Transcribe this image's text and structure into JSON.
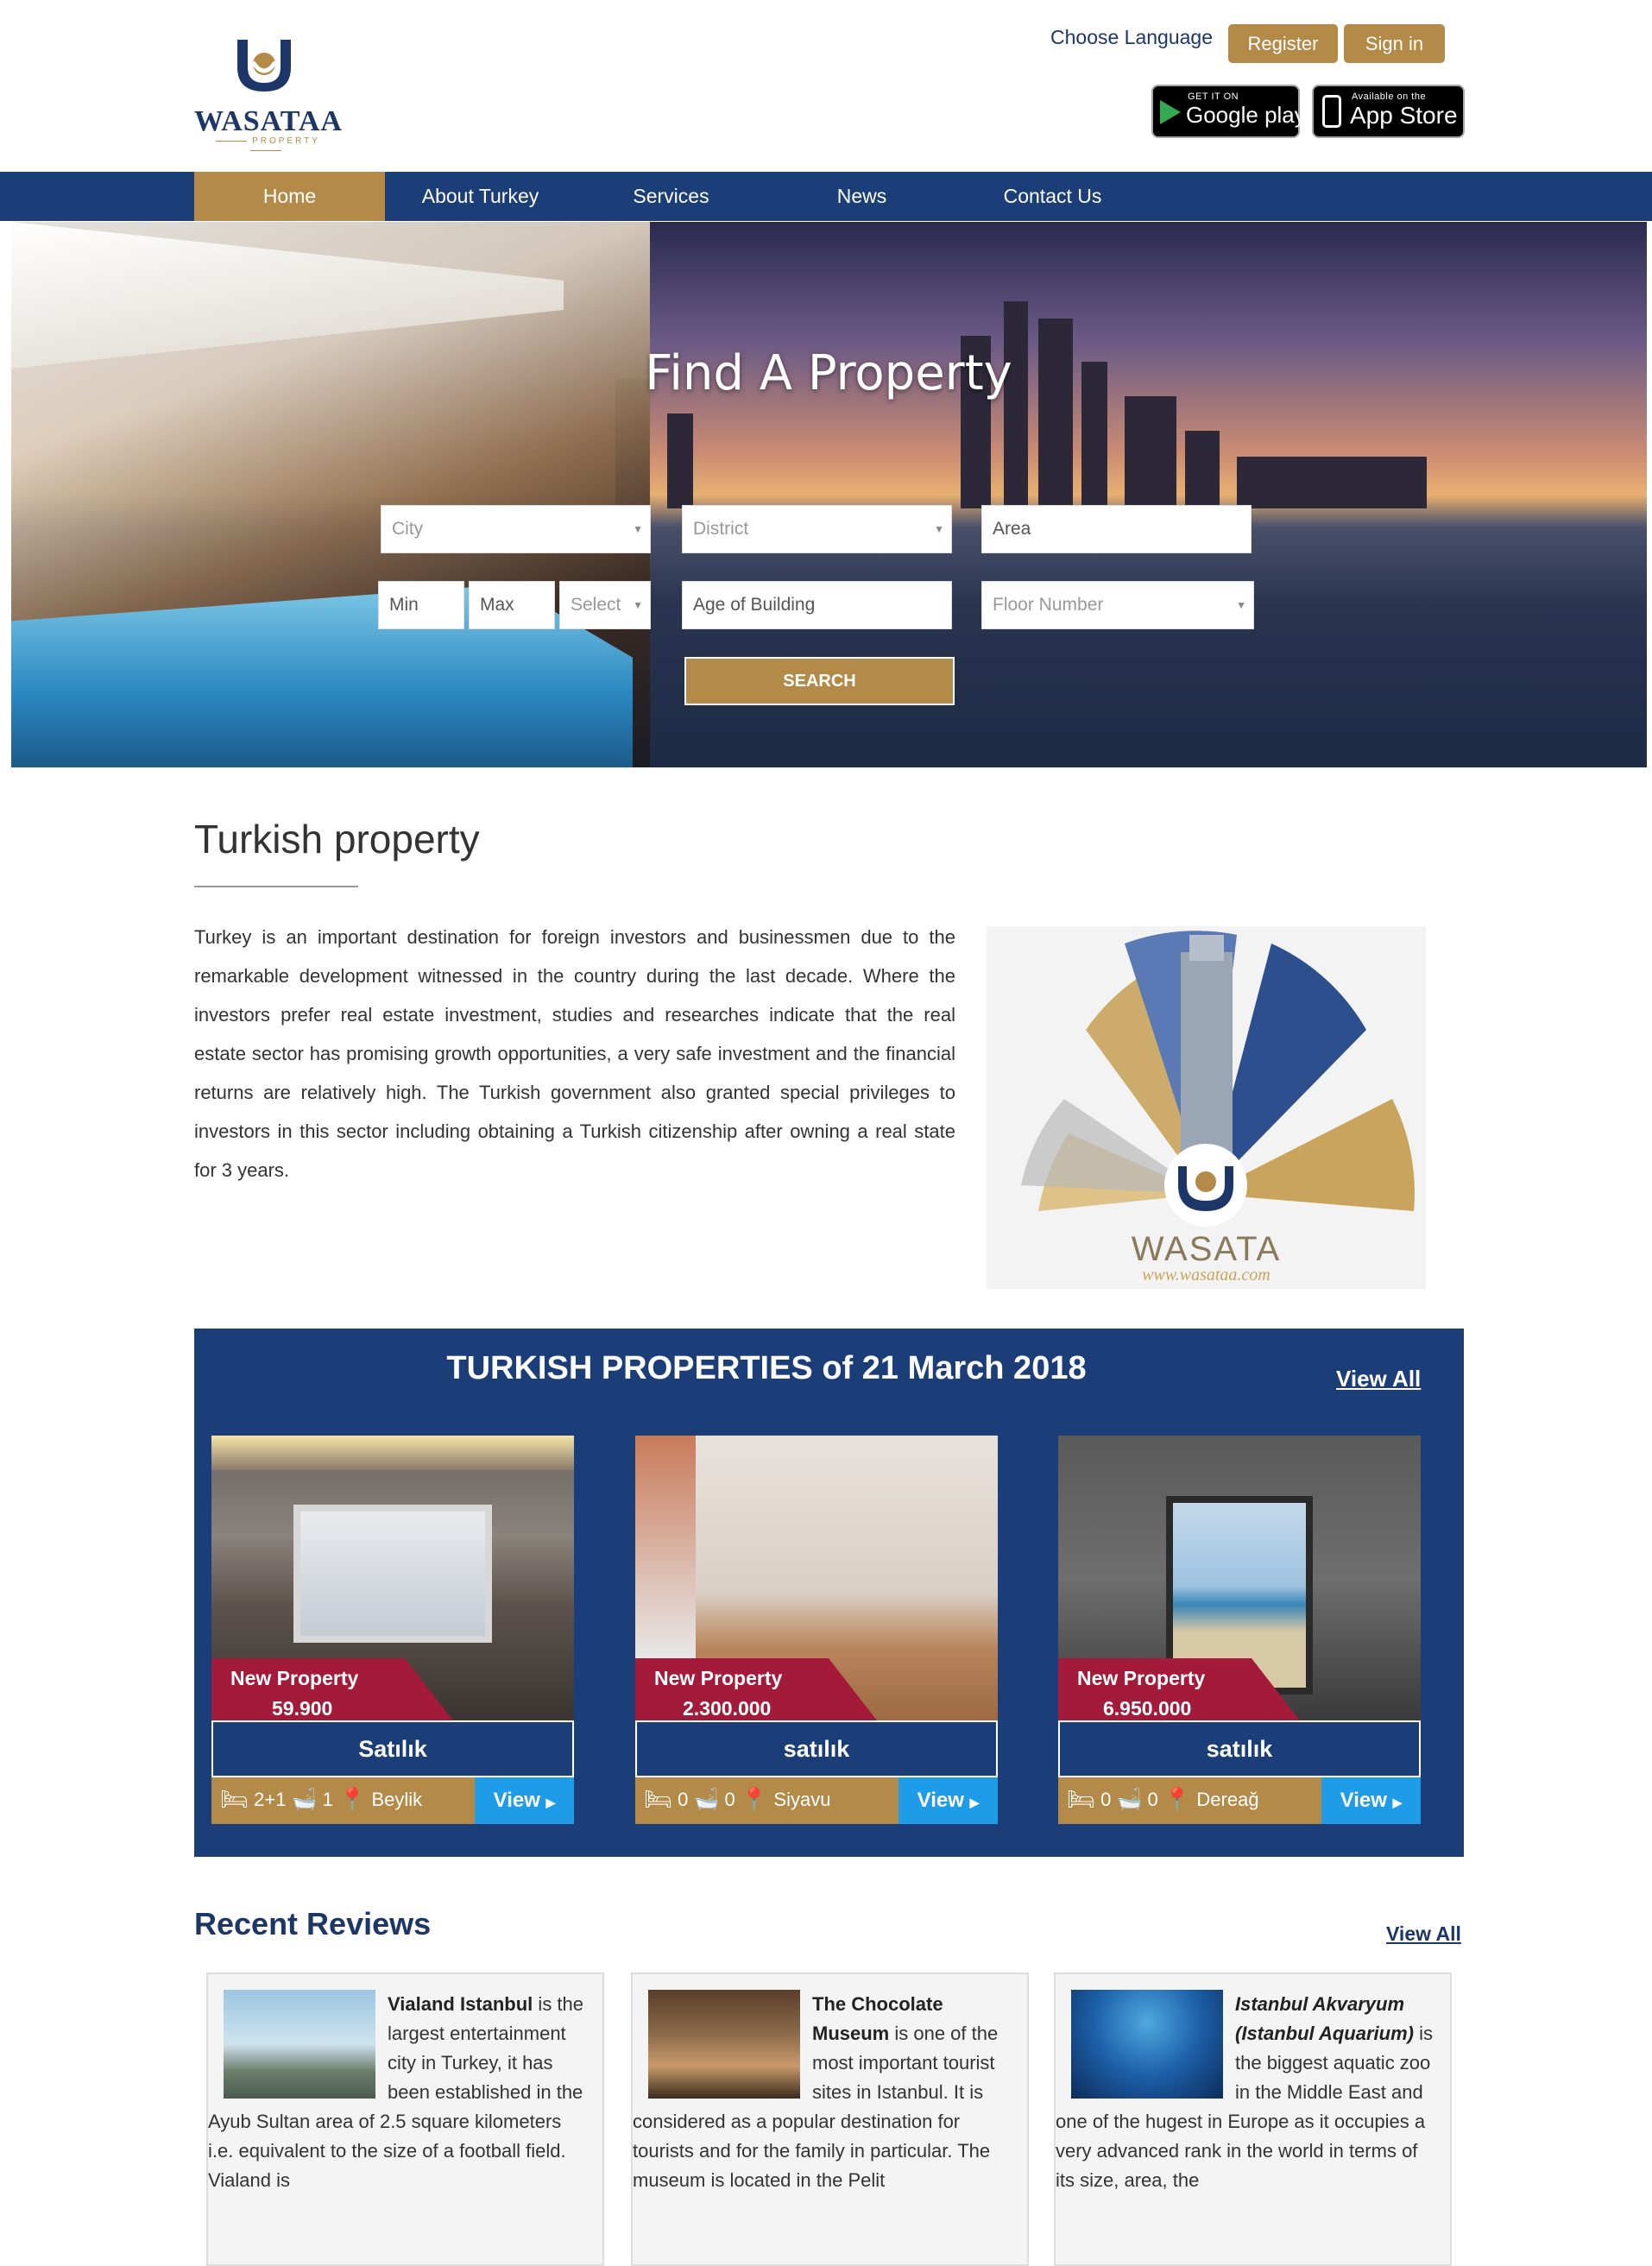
{
  "brand": {
    "name": "WASATAA",
    "tagline": "PROPERTY"
  },
  "header": {
    "choose_language": "Choose Language",
    "register": "Register",
    "sign_in": "Sign in",
    "google_play": {
      "small": "GET IT ON",
      "big": "Google play"
    },
    "app_store": {
      "small": "Available on the",
      "big": "App Store"
    }
  },
  "nav": {
    "items": [
      {
        "label": "Home",
        "active": true
      },
      {
        "label": "About Turkey"
      },
      {
        "label": "Services"
      },
      {
        "label": "News"
      },
      {
        "label": "Contact Us"
      }
    ]
  },
  "hero": {
    "title": "Find A Property",
    "city": "City",
    "district": "District",
    "area": "Area",
    "min": "Min",
    "max": "Max",
    "select": "Select",
    "age": "Age of Building",
    "floor": "Floor Number",
    "search": "SEARCH"
  },
  "turkish_property": {
    "title": "Turkish property",
    "text": "Turkey is an important destination for foreign investors and businessmen due to the remarkable development witnessed in the country during the last decade. Where the investors prefer real estate investment,  studies and researches indicate that the real estate sector has promising growth opportunities, a very safe investment and the financial returns are relatively high. The Turkish government also granted special privileges to investors in this sector including obtaining a Turkish citizenship after owning a real state for 3 years.",
    "image_text": {
      "brand": "WASATA",
      "url": "www.wasataa.com"
    }
  },
  "properties": {
    "title": "TURKISH PROPERTIES of 21 March 2018",
    "view_all": "View All",
    "cards": [
      {
        "badge": "New Property",
        "price": "59.900",
        "status": "Satılık",
        "rooms": "2+1",
        "baths": "1",
        "location": "Beylik",
        "view": "View"
      },
      {
        "badge": "New Property",
        "price": "2.300.000",
        "status": "satılık",
        "rooms": "0",
        "baths": "0",
        "location": "Siyavu",
        "view": "View"
      },
      {
        "badge": "New Property",
        "price": "6.950.000",
        "status": "satılık",
        "rooms": "0",
        "baths": "0",
        "location": "Dereağ",
        "view": "View"
      }
    ]
  },
  "reviews": {
    "title": "Recent Reviews",
    "view_all": "View All",
    "items": [
      {
        "name": "Vialand Istanbul",
        "text": " is the largest entertainment city in Turkey, it has been established in the Ayub Sultan area of 2.5 square kilometers i.e. equivalent to the size of a football field. Vialand is"
      },
      {
        "name": "The Chocolate Museum",
        "text": "  is one of the most important tourist sites in Istanbul. It is considered as a popular destination for tourists and for the family in particular. The museum is located in the Pelit"
      },
      {
        "name": "Istanbul Akvaryum (Istanbul Aquarium)",
        "text": " is the biggest aquatic zoo in the Middle East and one of the hugest in Europe as it occupies a very advanced rank in the world in terms of  its size, area, the"
      }
    ]
  },
  "colors": {
    "navy": "#1c3e78",
    "gold": "#b48a48",
    "crimson": "#a31a3a",
    "blue_btn": "#1f9ce8"
  }
}
